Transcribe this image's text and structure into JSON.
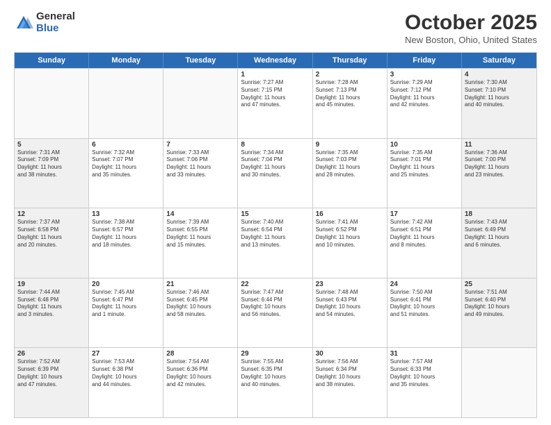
{
  "logo": {
    "general": "General",
    "blue": "Blue"
  },
  "header": {
    "month": "October 2025",
    "location": "New Boston, Ohio, United States"
  },
  "weekdays": [
    "Sunday",
    "Monday",
    "Tuesday",
    "Wednesday",
    "Thursday",
    "Friday",
    "Saturday"
  ],
  "weeks": [
    [
      {
        "day": "",
        "info": ""
      },
      {
        "day": "",
        "info": ""
      },
      {
        "day": "",
        "info": ""
      },
      {
        "day": "1",
        "info": "Sunrise: 7:27 AM\nSunset: 7:15 PM\nDaylight: 11 hours\nand 47 minutes."
      },
      {
        "day": "2",
        "info": "Sunrise: 7:28 AM\nSunset: 7:13 PM\nDaylight: 11 hours\nand 45 minutes."
      },
      {
        "day": "3",
        "info": "Sunrise: 7:29 AM\nSunset: 7:12 PM\nDaylight: 11 hours\nand 42 minutes."
      },
      {
        "day": "4",
        "info": "Sunrise: 7:30 AM\nSunset: 7:10 PM\nDaylight: 11 hours\nand 40 minutes."
      }
    ],
    [
      {
        "day": "5",
        "info": "Sunrise: 7:31 AM\nSunset: 7:09 PM\nDaylight: 11 hours\nand 38 minutes."
      },
      {
        "day": "6",
        "info": "Sunrise: 7:32 AM\nSunset: 7:07 PM\nDaylight: 11 hours\nand 35 minutes."
      },
      {
        "day": "7",
        "info": "Sunrise: 7:33 AM\nSunset: 7:06 PM\nDaylight: 11 hours\nand 33 minutes."
      },
      {
        "day": "8",
        "info": "Sunrise: 7:34 AM\nSunset: 7:04 PM\nDaylight: 11 hours\nand 30 minutes."
      },
      {
        "day": "9",
        "info": "Sunrise: 7:35 AM\nSunset: 7:03 PM\nDaylight: 11 hours\nand 28 minutes."
      },
      {
        "day": "10",
        "info": "Sunrise: 7:35 AM\nSunset: 7:01 PM\nDaylight: 11 hours\nand 25 minutes."
      },
      {
        "day": "11",
        "info": "Sunrise: 7:36 AM\nSunset: 7:00 PM\nDaylight: 11 hours\nand 23 minutes."
      }
    ],
    [
      {
        "day": "12",
        "info": "Sunrise: 7:37 AM\nSunset: 6:58 PM\nDaylight: 11 hours\nand 20 minutes."
      },
      {
        "day": "13",
        "info": "Sunrise: 7:38 AM\nSunset: 6:57 PM\nDaylight: 11 hours\nand 18 minutes."
      },
      {
        "day": "14",
        "info": "Sunrise: 7:39 AM\nSunset: 6:55 PM\nDaylight: 11 hours\nand 15 minutes."
      },
      {
        "day": "15",
        "info": "Sunrise: 7:40 AM\nSunset: 6:54 PM\nDaylight: 11 hours\nand 13 minutes."
      },
      {
        "day": "16",
        "info": "Sunrise: 7:41 AM\nSunset: 6:52 PM\nDaylight: 11 hours\nand 10 minutes."
      },
      {
        "day": "17",
        "info": "Sunrise: 7:42 AM\nSunset: 6:51 PM\nDaylight: 11 hours\nand 8 minutes."
      },
      {
        "day": "18",
        "info": "Sunrise: 7:43 AM\nSunset: 6:49 PM\nDaylight: 11 hours\nand 6 minutes."
      }
    ],
    [
      {
        "day": "19",
        "info": "Sunrise: 7:44 AM\nSunset: 6:48 PM\nDaylight: 11 hours\nand 3 minutes."
      },
      {
        "day": "20",
        "info": "Sunrise: 7:45 AM\nSunset: 6:47 PM\nDaylight: 11 hours\nand 1 minute."
      },
      {
        "day": "21",
        "info": "Sunrise: 7:46 AM\nSunset: 6:45 PM\nDaylight: 10 hours\nand 58 minutes."
      },
      {
        "day": "22",
        "info": "Sunrise: 7:47 AM\nSunset: 6:44 PM\nDaylight: 10 hours\nand 56 minutes."
      },
      {
        "day": "23",
        "info": "Sunrise: 7:48 AM\nSunset: 6:43 PM\nDaylight: 10 hours\nand 54 minutes."
      },
      {
        "day": "24",
        "info": "Sunrise: 7:50 AM\nSunset: 6:41 PM\nDaylight: 10 hours\nand 51 minutes."
      },
      {
        "day": "25",
        "info": "Sunrise: 7:51 AM\nSunset: 6:40 PM\nDaylight: 10 hours\nand 49 minutes."
      }
    ],
    [
      {
        "day": "26",
        "info": "Sunrise: 7:52 AM\nSunset: 6:39 PM\nDaylight: 10 hours\nand 47 minutes."
      },
      {
        "day": "27",
        "info": "Sunrise: 7:53 AM\nSunset: 6:38 PM\nDaylight: 10 hours\nand 44 minutes."
      },
      {
        "day": "28",
        "info": "Sunrise: 7:54 AM\nSunset: 6:36 PM\nDaylight: 10 hours\nand 42 minutes."
      },
      {
        "day": "29",
        "info": "Sunrise: 7:55 AM\nSunset: 6:35 PM\nDaylight: 10 hours\nand 40 minutes."
      },
      {
        "day": "30",
        "info": "Sunrise: 7:56 AM\nSunset: 6:34 PM\nDaylight: 10 hours\nand 38 minutes."
      },
      {
        "day": "31",
        "info": "Sunrise: 7:57 AM\nSunset: 6:33 PM\nDaylight: 10 hours\nand 35 minutes."
      },
      {
        "day": "",
        "info": ""
      }
    ]
  ]
}
